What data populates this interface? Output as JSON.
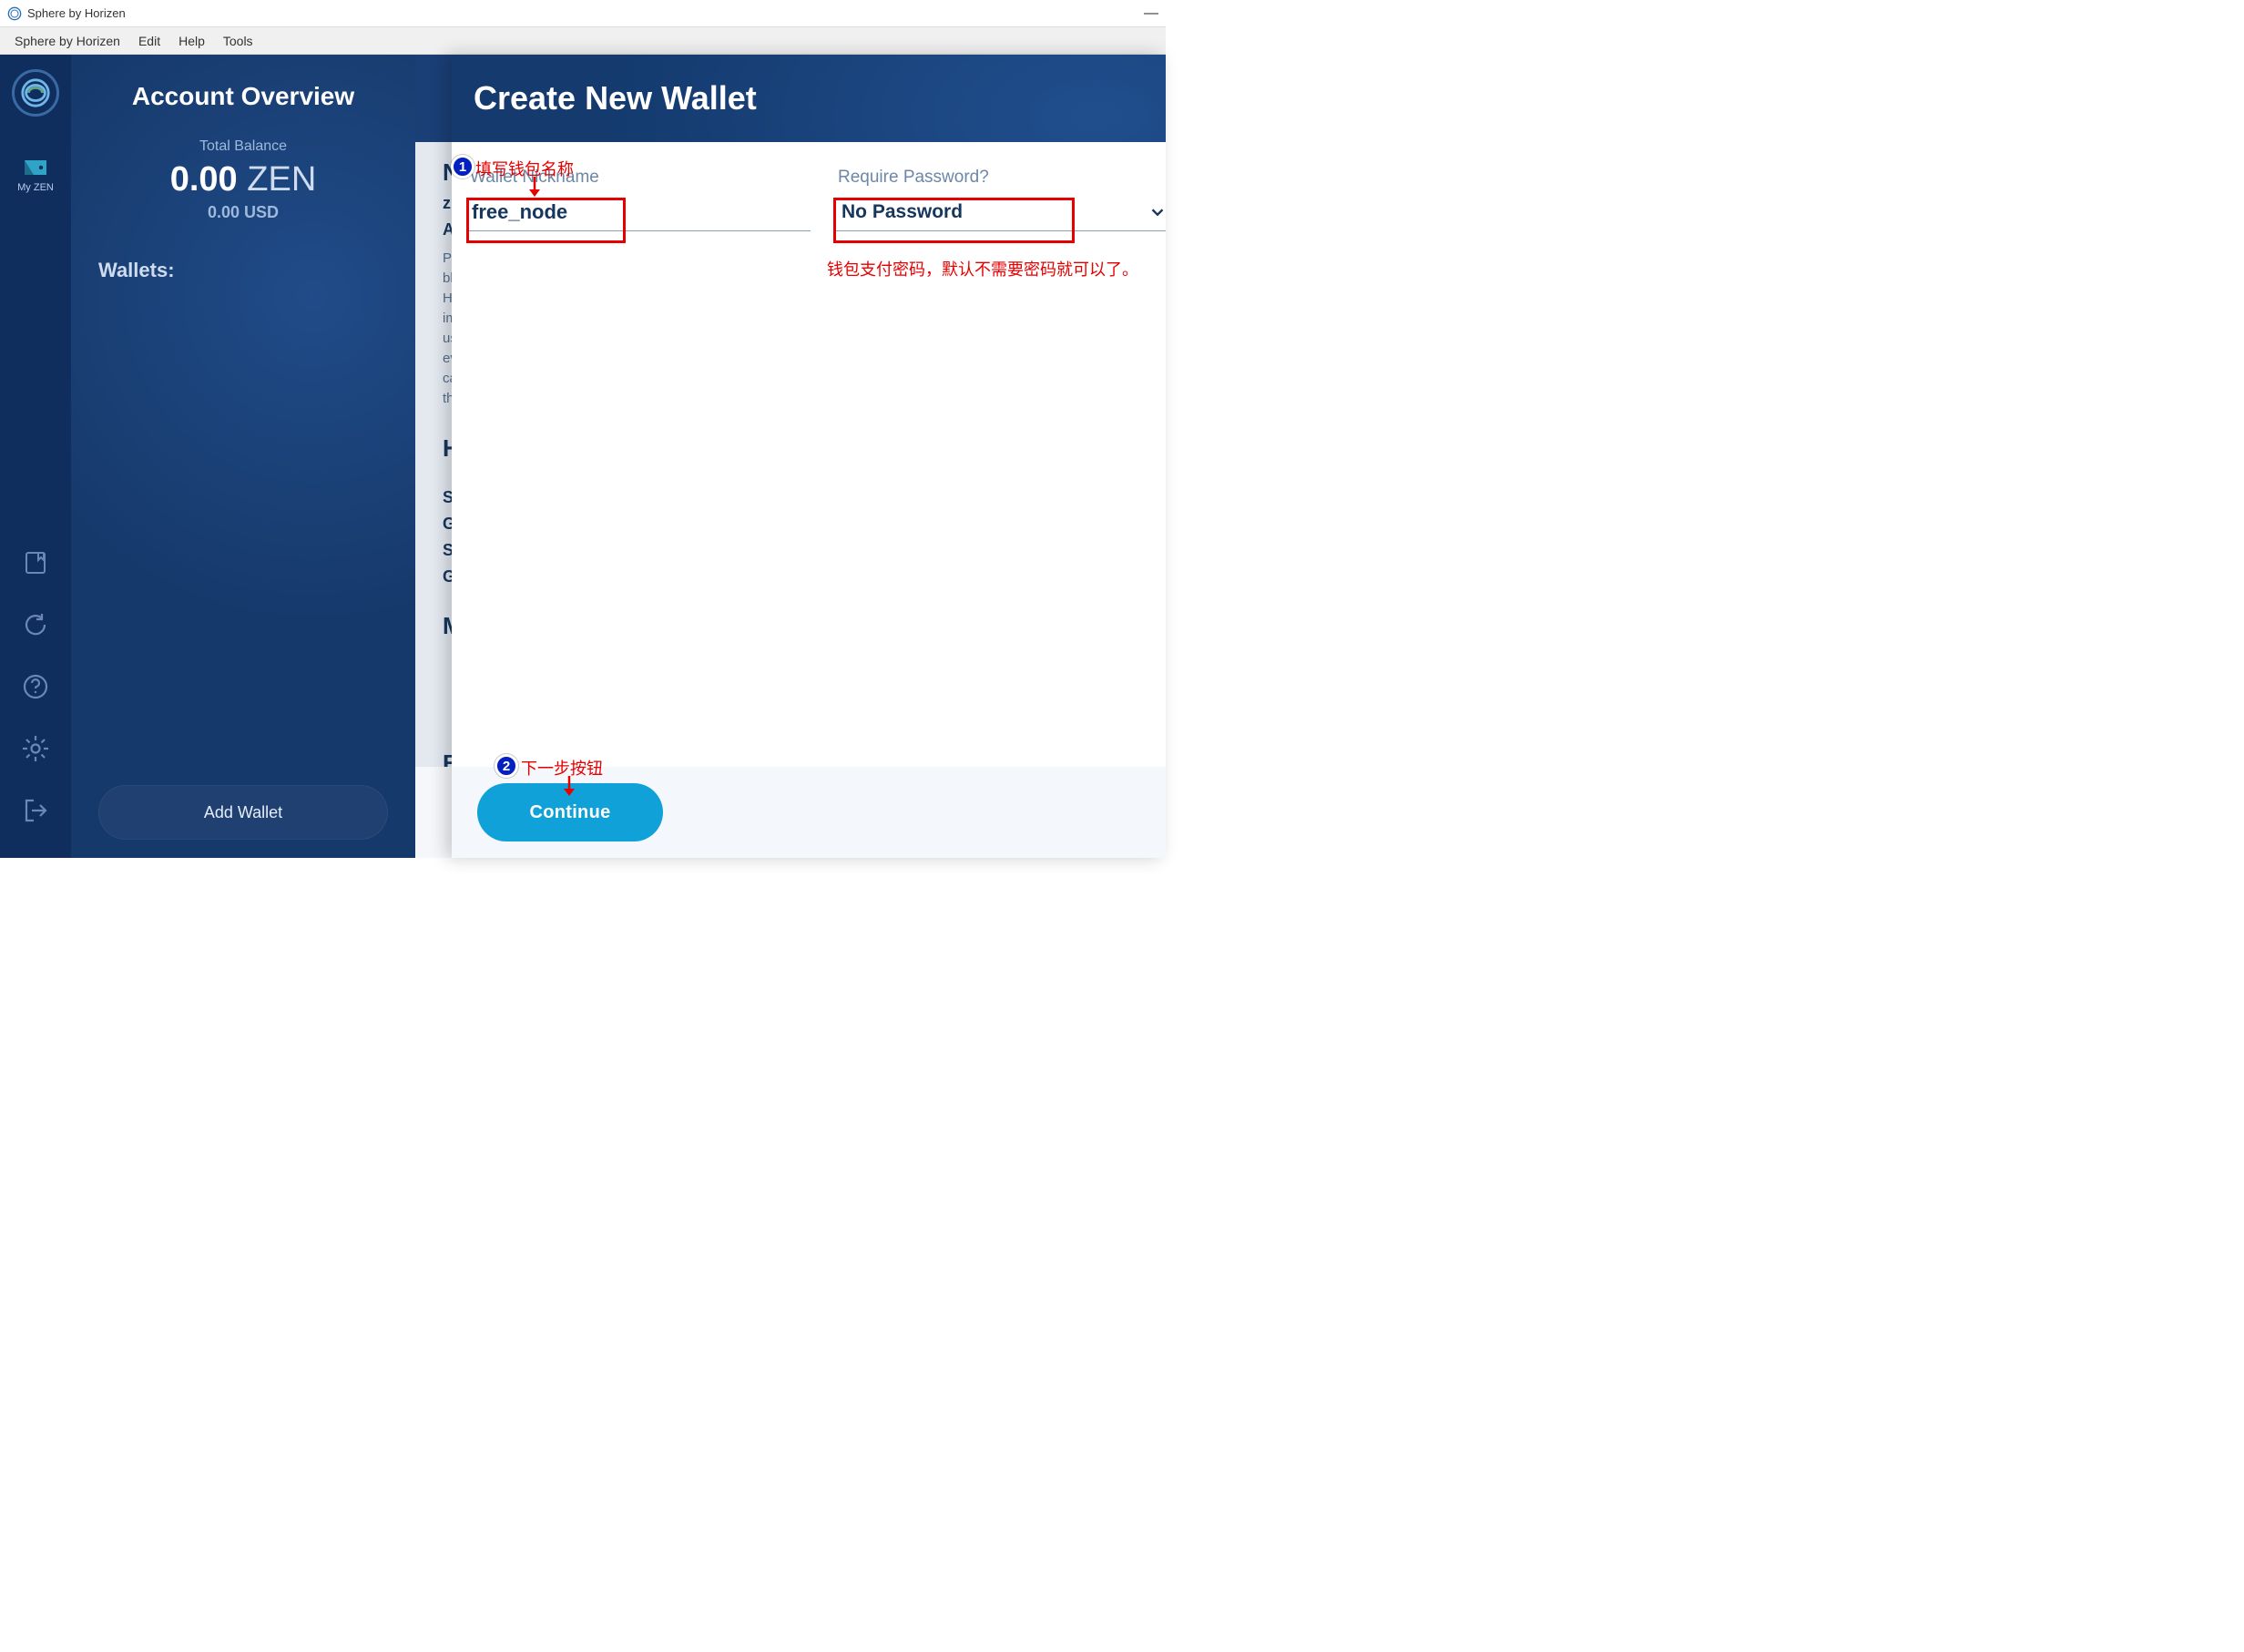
{
  "titlebar": {
    "title": "Sphere by Horizen",
    "minimize": "—"
  },
  "menubar": {
    "items": [
      "Sphere by Horizen",
      "Edit",
      "Help",
      "Tools"
    ]
  },
  "rail": {
    "myzen_label": "My ZEN"
  },
  "sidebar": {
    "heading": "Account Overview",
    "balance_label": "Total Balance",
    "balance_value": "0.00",
    "balance_currency": "ZEN",
    "balance_sub": "0.00",
    "balance_sub_currency": "USD",
    "wallets_label": "Wallets:",
    "add_wallet": "Add Wallet"
  },
  "bg": {
    "heading1": "Ne",
    "sub1": "zk-",
    "sub2": "Ap",
    "para_lines": [
      "Priv",
      "blo",
      "Ho",
      "imp",
      "usi",
      "eve",
      "car",
      "tha"
    ],
    "heading2": "Ho",
    "row1a": "S",
    "row1b": "G",
    "row2a": "S",
    "row2b": "G",
    "heading3": "Ma",
    "heading4": "Bl"
  },
  "modal": {
    "title": "Create New Wallet",
    "nickname_label": "Wallet Nickname",
    "nickname_value": "free_node",
    "password_label": "Require Password?",
    "password_value": "No Password",
    "continue": "Continue"
  },
  "annotations": {
    "badge1": "1",
    "badge2": "2",
    "text1": "填写钱包名称",
    "text2": "钱包支付密码，默认不需要密码就可以了。",
    "text3": "下一步按钮"
  }
}
